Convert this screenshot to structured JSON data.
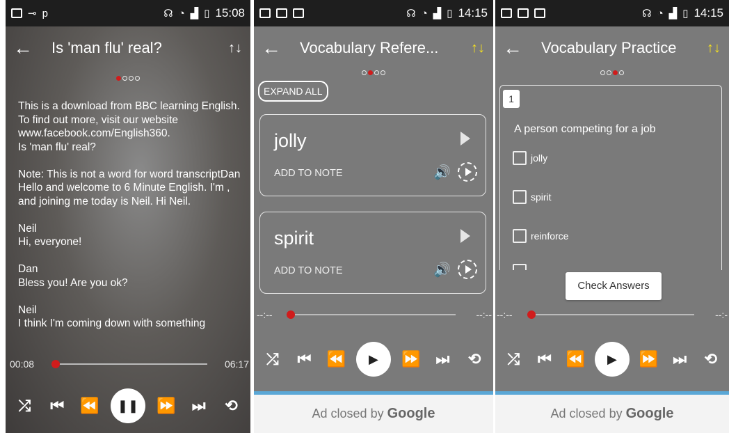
{
  "panel1": {
    "status_time": "15:08",
    "status_letter": "p",
    "title": "Is 'man flu' real?",
    "transcript": "This is a download from BBC learning English. To find out more, visit our website www.facebook.com/English360.\nIs 'man flu' real?\n\nNote: This is not a word for word transcriptDan\nHello and welcome to 6 Minute English. I'm , and joining me today is Neil. Hi Neil.\n\nNeil\nHi, everyone!\n\nDan\nBless you! Are you ok?\n\nNeil\nI think I'm coming down with something",
    "elapsed": "00:08",
    "duration": "06:17",
    "progress": 0.02
  },
  "panel2": {
    "status_time": "14:15",
    "title": "Vocabulary Refere...",
    "expand_all": "EXPAND ALL",
    "cards": [
      {
        "word": "jolly",
        "note": "ADD TO NOTE"
      },
      {
        "word": "spirit",
        "note": "ADD TO NOTE"
      }
    ],
    "elapsed": "--:--",
    "duration": "--:--",
    "ad_text": "Ad closed by",
    "ad_brand": "Google"
  },
  "panel3": {
    "status_time": "14:15",
    "title": "Vocabulary Practice",
    "question_number": "1",
    "question": "A person competing for a job",
    "options": [
      "jolly",
      "spirit",
      "reinforce"
    ],
    "check_answers": "Check Answers",
    "elapsed": "--:--",
    "duration": "--:-",
    "ad_text": "Ad closed by",
    "ad_brand": "Google"
  },
  "colors": {
    "accent_red": "#d01c1c",
    "sort_yellow": "#f5e11f",
    "ad_bar_blue": "#5aa7d6"
  },
  "icons": [
    "back-arrow-icon",
    "sort-icon",
    "shuffle-icon",
    "skip-previous-icon",
    "rewind-icon",
    "pause-icon",
    "play-icon",
    "fast-forward-icon",
    "skip-next-icon",
    "repeat-icon",
    "speaker-icon",
    "speed-icon"
  ]
}
